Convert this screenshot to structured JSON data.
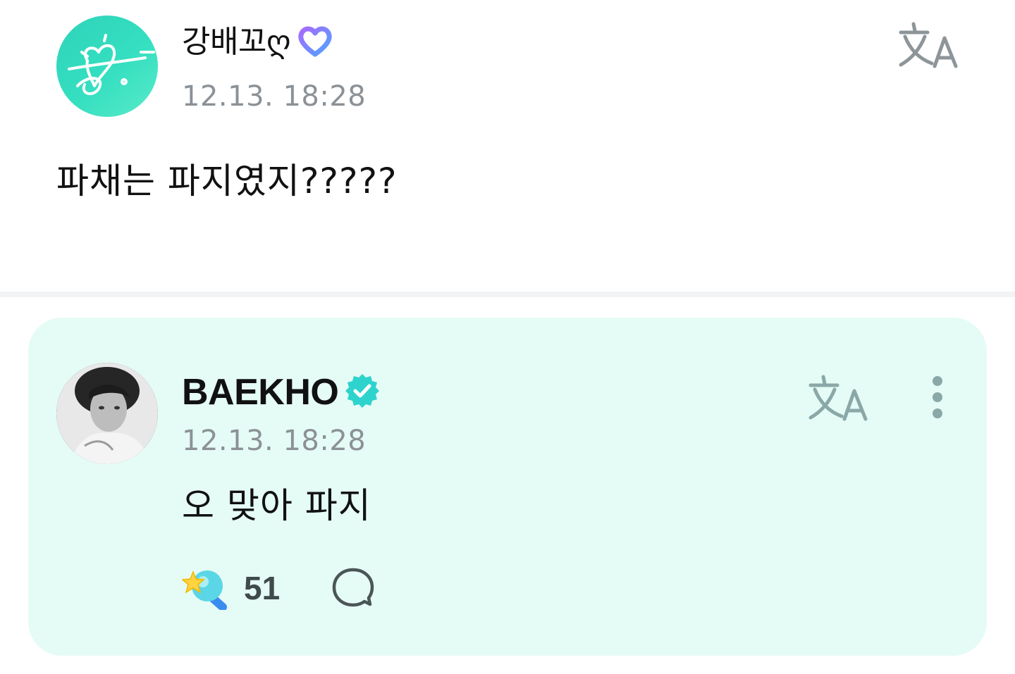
{
  "fan_post": {
    "author": {
      "name": "강배꼬ღ",
      "name_suffix_glyph": "ෆ",
      "avatar_icon": "heart-signature-avatar",
      "badge_icon": "membership-heart-badge-icon",
      "badge_color": "#6b8cff"
    },
    "timestamp": "12.13. 18:28",
    "text": "파채는 파지였지?????",
    "translate_icon": "translate-icon"
  },
  "artist_reply": {
    "author": {
      "name": "BAEKHO",
      "avatar_icon": "artist-profile-photo",
      "badge_icon": "verified-badge-icon",
      "badge_color": "#2ed3cd"
    },
    "timestamp": "12.13. 18:28",
    "text": "오 맞아 파지",
    "translate_icon": "translate-icon",
    "more_icon": "more-vertical-icon",
    "likes": {
      "icon": "lightstick-like-icon",
      "count": "51"
    },
    "comment_icon": "comment-bubble-icon"
  },
  "colors": {
    "reply_background": "#e5fbf6",
    "timestamp": "#8b9196",
    "icon_gray": "#8d9599",
    "icon_teal_gray": "#8aa8a8"
  }
}
